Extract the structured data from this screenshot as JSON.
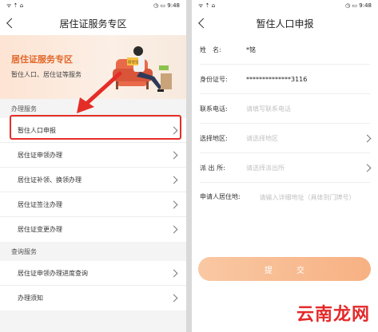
{
  "status_bar": {
    "left": "ᯤ ⇡ ⌂",
    "right": "◷ ▭ 9:48"
  },
  "left_screen": {
    "title": "居住证服务专区",
    "banner": {
      "title": "居住证服务专区",
      "subtitle": "暂住人口、居住证等服务",
      "sign": "居住证"
    },
    "sections": [
      {
        "header": "办理服务",
        "items": [
          "暂住人口申报",
          "居住证申领办理",
          "居住证补领、换领办理",
          "居住证签注办理",
          "居住证变更办理"
        ]
      },
      {
        "header": "查询服务",
        "items": [
          "居住证申领办理进度查询",
          "办理须知"
        ]
      }
    ]
  },
  "right_screen": {
    "title": "暂住人口申报",
    "fields": {
      "name": {
        "label": "姓　名:",
        "value": "*铭"
      },
      "id": {
        "label": "身份证号:",
        "value": "**************3116"
      },
      "phone": {
        "label": "联系电话:",
        "placeholder": "请填写联系电话"
      },
      "region": {
        "label": "选择地区:",
        "placeholder": "请选择地区"
      },
      "station": {
        "label": "派 出 所:",
        "placeholder": "请选择派出所"
      },
      "address": {
        "label": "申请人居住地:",
        "placeholder": "请输入详细地址（具体到门牌号）"
      }
    },
    "submit_label": "提交"
  },
  "watermark": "云南龙网",
  "colors": {
    "accent": "#e0672a",
    "highlight": "#e52d27",
    "submit": "#f7b183"
  }
}
